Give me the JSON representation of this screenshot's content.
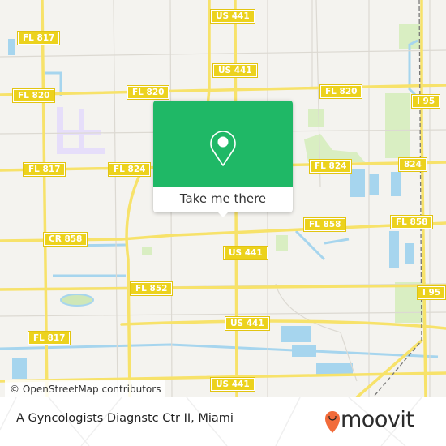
{
  "map": {
    "road_labels": [
      {
        "id": "fl817-nw",
        "text": "FL 817"
      },
      {
        "id": "us441-top",
        "text": "US 441"
      },
      {
        "id": "fl820-w",
        "text": "FL 820"
      },
      {
        "id": "fl820-mid",
        "text": "FL 820"
      },
      {
        "id": "us441-2",
        "text": "US 441"
      },
      {
        "id": "fl820-e",
        "text": "FL 820"
      },
      {
        "id": "i95-n",
        "text": "I 95"
      },
      {
        "id": "fl817-w",
        "text": "FL 817"
      },
      {
        "id": "fl824-w",
        "text": "FL 824"
      },
      {
        "id": "fl824-e",
        "text": "FL 824"
      },
      {
        "id": "r824",
        "text": "824"
      },
      {
        "id": "cr858",
        "text": "CR 858"
      },
      {
        "id": "fl858-mid",
        "text": "FL 858"
      },
      {
        "id": "fl858-e",
        "text": "FL 858"
      },
      {
        "id": "us441-3",
        "text": "US 441"
      },
      {
        "id": "fl852",
        "text": "FL 852"
      },
      {
        "id": "i95-s",
        "text": "I 95"
      },
      {
        "id": "us441-4",
        "text": "US 441"
      },
      {
        "id": "fl817-sw",
        "text": "FL 817"
      },
      {
        "id": "us441-5",
        "text": "US 441"
      }
    ],
    "attribution": "© OpenStreetMap contributors",
    "colors": {
      "road": "#f7e26a",
      "shield": "#ecd21d",
      "water": "#a6d5ee",
      "park": "#d9eec2",
      "land": "#f4f3ef"
    }
  },
  "popup": {
    "icon": "map-pin-icon",
    "button_label": "Take me there",
    "accent": "#1fb866"
  },
  "footer": {
    "place_name": "A Gyncologists Diagnstc Ctr II, Miami",
    "logo_text": "moovit",
    "logo_color": "#f26b3a"
  }
}
